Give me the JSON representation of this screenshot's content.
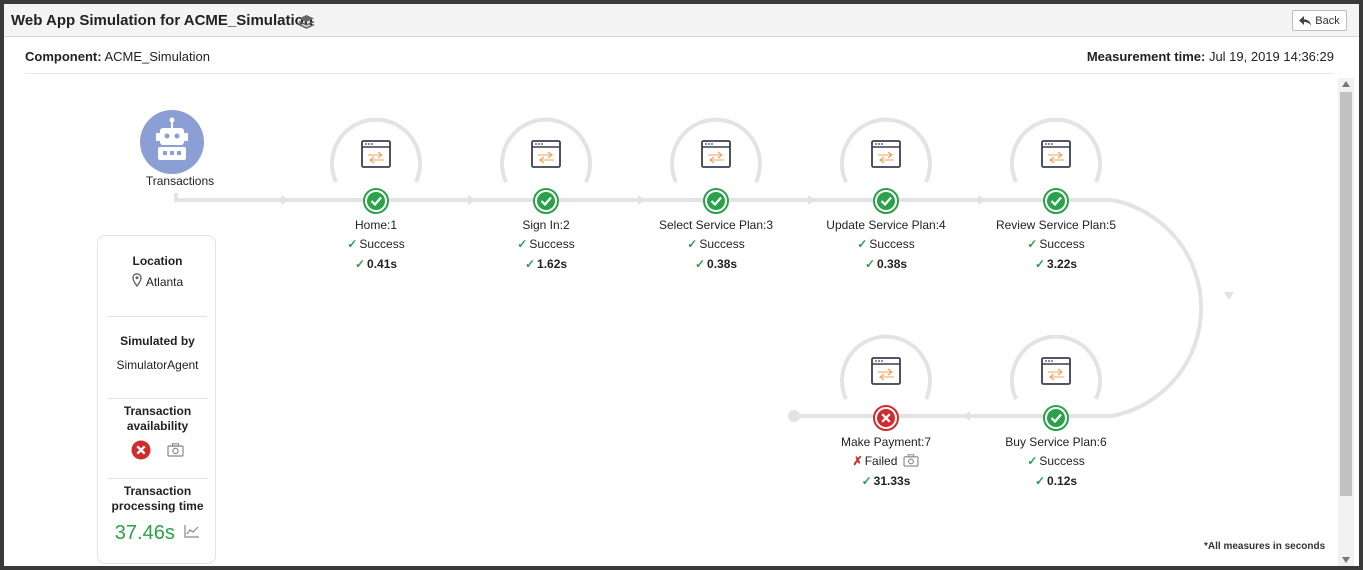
{
  "window": {
    "title": "Web App Simulation for ACME_Simulation",
    "back_label": "Back"
  },
  "info": {
    "component_label": "Component:",
    "component_value": "ACME_Simulation",
    "measure_label": "Measurement time:",
    "measure_value": "Jul 19, 2019 14:36:29"
  },
  "origin": {
    "label": "Transactions"
  },
  "steps": [
    {
      "name": "Home:1",
      "status": "Success",
      "time": "0.41s",
      "ok": true
    },
    {
      "name": "Sign In:2",
      "status": "Success",
      "time": "1.62s",
      "ok": true
    },
    {
      "name": "Select Service Plan:3",
      "status": "Success",
      "time": "0.38s",
      "ok": true
    },
    {
      "name": "Update Service Plan:4",
      "status": "Success",
      "time": "0.38s",
      "ok": true
    },
    {
      "name": "Review Service Plan:5",
      "status": "Success",
      "time": "3.22s",
      "ok": true
    },
    {
      "name": "Buy Service Plan:6",
      "status": "Success",
      "time": "0.12s",
      "ok": true
    },
    {
      "name": "Make Payment:7",
      "status": "Failed",
      "time": "31.33s",
      "ok": false
    }
  ],
  "side": {
    "location_label": "Location",
    "location_value": "Atlanta",
    "simulated_label": "Simulated by",
    "simulated_value": "SimulatorAgent",
    "availability_label": "Transaction availability",
    "processing_label": "Transaction processing time",
    "processing_value": "37.46s"
  },
  "footnote": "*All measures in seconds",
  "icons": {
    "back": "back-arrow-icon",
    "layers": "layers-icon",
    "robot": "robot-icon",
    "browser": "browser-window-icon",
    "success": "check-circle-icon",
    "failure": "x-circle-icon",
    "location": "map-pin-icon",
    "camera": "camera-icon",
    "chart": "line-chart-icon"
  },
  "colors": {
    "success": "#2aa14a",
    "failure": "#d12b2b",
    "robot": "#8c9fd4",
    "processing_time": "#2aa14a"
  }
}
